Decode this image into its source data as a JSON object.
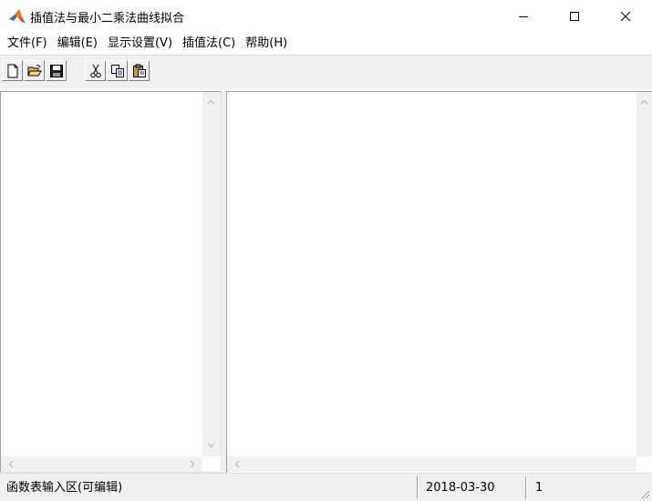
{
  "window": {
    "title": "插值法与最小二乘法曲线拟合"
  },
  "menu": {
    "items": [
      "文件(F)",
      "编辑(E)",
      "显示设置(V)",
      "插值法(C)",
      "帮助(H)"
    ]
  },
  "toolbar": {
    "buttons": [
      "new-file",
      "open-folder",
      "save",
      "cut",
      "copy",
      "paste"
    ]
  },
  "status": {
    "hint": "函数表输入区(可编辑)",
    "date": "2018-03-30",
    "extra": "1"
  },
  "colors": {
    "chrome": "#f0f0f0",
    "pane": "#ffffff",
    "border": "#a0a0a0"
  }
}
